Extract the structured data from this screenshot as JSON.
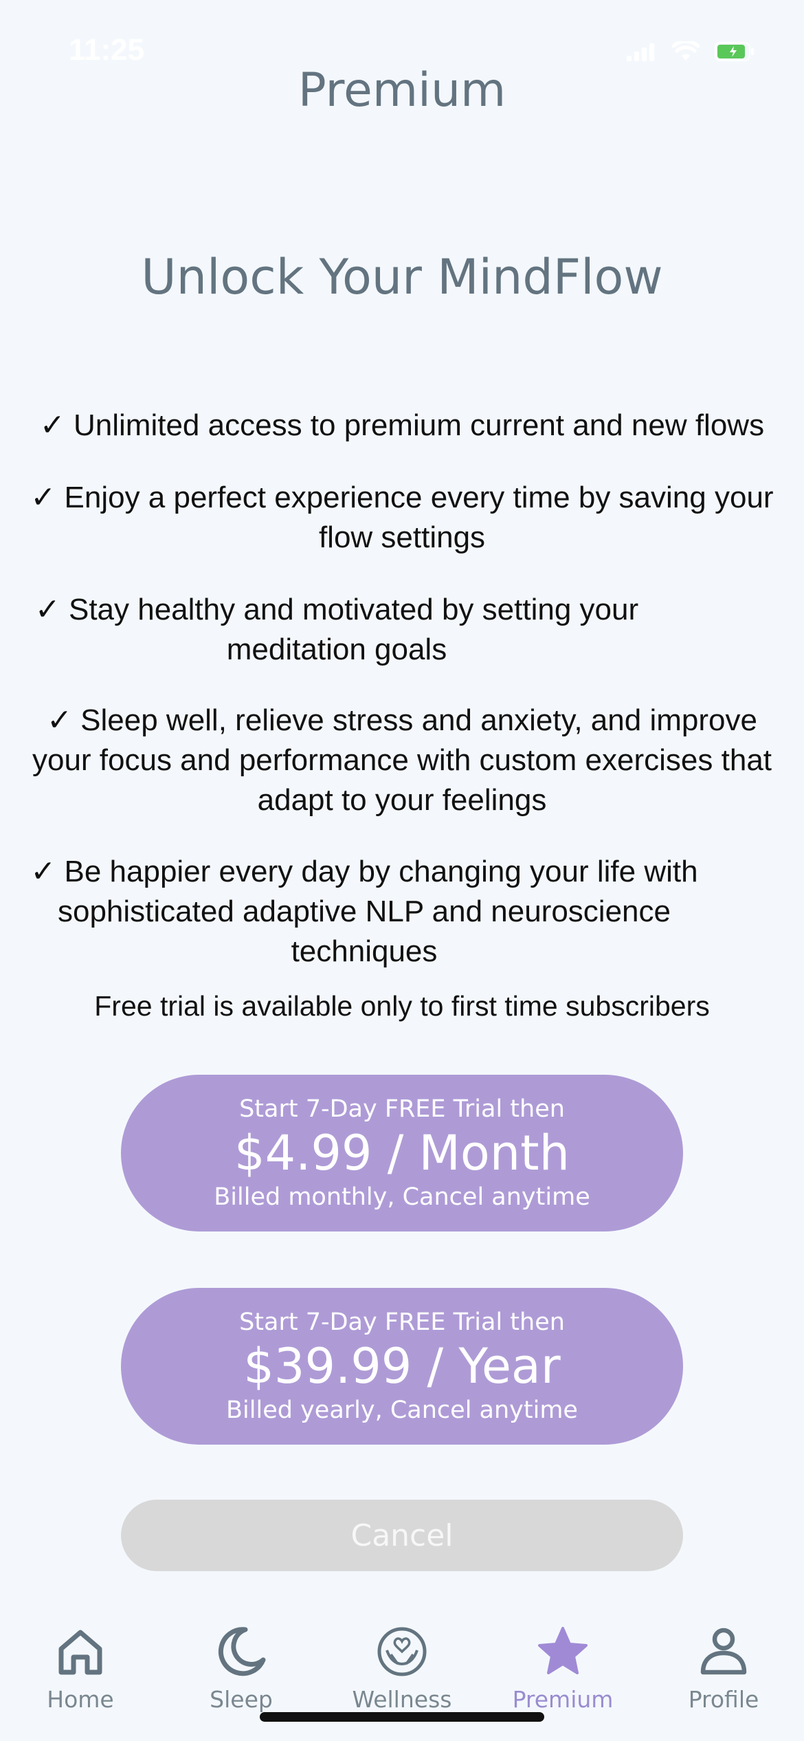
{
  "status_bar": {
    "time": "11:25"
  },
  "nav": {
    "title": "Premium"
  },
  "headline": "Unlock Your MindFlow",
  "features": [
    {
      "line1": "✓ Unlimited access to premium current and new flows",
      "line2": "",
      "line3": ""
    },
    {
      "line1": "✓ Enjoy a perfect experience every time by saving your",
      "line2": "flow settings",
      "line3": ""
    },
    {
      "line1": "✓ Stay healthy and motivated by setting your",
      "line2": "meditation goals",
      "line3": ""
    },
    {
      "line1": "✓ Sleep well, relieve stress and anxiety, and improve",
      "line2": "your focus and performance with custom exercises that",
      "line3": "adapt to your feelings"
    },
    {
      "line1": "✓ Be happier every day by changing your life with",
      "line2": "sophisticated adaptive NLP and neuroscience",
      "line3": "techniques"
    }
  ],
  "trial_note": "Free trial is available only to first time subscribers",
  "plans": {
    "monthly": {
      "top": "Start 7-Day FREE Trial then",
      "price": "$4.99 / Month",
      "bottom": "Billed monthly, Cancel anytime"
    },
    "yearly": {
      "top": "Start 7-Day FREE Trial then",
      "price": "$39.99 / Year",
      "bottom": "Billed yearly, Cancel anytime"
    }
  },
  "cancel_label": "Cancel",
  "tabs": [
    {
      "label": "Home",
      "icon": "home-icon"
    },
    {
      "label": "Sleep",
      "icon": "moon-icon"
    },
    {
      "label": "Wellness",
      "icon": "wellness-icon"
    },
    {
      "label": "Premium",
      "icon": "star-icon"
    },
    {
      "label": "Profile",
      "icon": "person-icon"
    }
  ],
  "colors": {
    "background": "#f4f8fc",
    "accent": "#ae9bd6",
    "title_gray": "#637480",
    "tab_inactive": "#637480",
    "tab_active": "#9a8cd0"
  }
}
